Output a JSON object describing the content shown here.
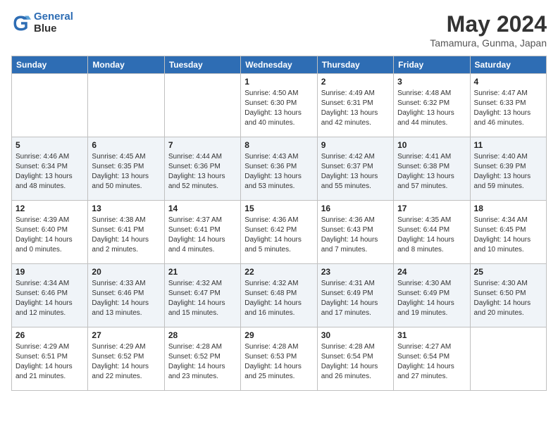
{
  "header": {
    "logo_line1": "General",
    "logo_line2": "Blue",
    "month_year": "May 2024",
    "location": "Tamamura, Gunma, Japan"
  },
  "weekdays": [
    "Sunday",
    "Monday",
    "Tuesday",
    "Wednesday",
    "Thursday",
    "Friday",
    "Saturday"
  ],
  "weeks": [
    [
      {
        "day": "",
        "info": ""
      },
      {
        "day": "",
        "info": ""
      },
      {
        "day": "",
        "info": ""
      },
      {
        "day": "1",
        "info": "Sunrise: 4:50 AM\nSunset: 6:30 PM\nDaylight: 13 hours\nand 40 minutes."
      },
      {
        "day": "2",
        "info": "Sunrise: 4:49 AM\nSunset: 6:31 PM\nDaylight: 13 hours\nand 42 minutes."
      },
      {
        "day": "3",
        "info": "Sunrise: 4:48 AM\nSunset: 6:32 PM\nDaylight: 13 hours\nand 44 minutes."
      },
      {
        "day": "4",
        "info": "Sunrise: 4:47 AM\nSunset: 6:33 PM\nDaylight: 13 hours\nand 46 minutes."
      }
    ],
    [
      {
        "day": "5",
        "info": "Sunrise: 4:46 AM\nSunset: 6:34 PM\nDaylight: 13 hours\nand 48 minutes."
      },
      {
        "day": "6",
        "info": "Sunrise: 4:45 AM\nSunset: 6:35 PM\nDaylight: 13 hours\nand 50 minutes."
      },
      {
        "day": "7",
        "info": "Sunrise: 4:44 AM\nSunset: 6:36 PM\nDaylight: 13 hours\nand 52 minutes."
      },
      {
        "day": "8",
        "info": "Sunrise: 4:43 AM\nSunset: 6:36 PM\nDaylight: 13 hours\nand 53 minutes."
      },
      {
        "day": "9",
        "info": "Sunrise: 4:42 AM\nSunset: 6:37 PM\nDaylight: 13 hours\nand 55 minutes."
      },
      {
        "day": "10",
        "info": "Sunrise: 4:41 AM\nSunset: 6:38 PM\nDaylight: 13 hours\nand 57 minutes."
      },
      {
        "day": "11",
        "info": "Sunrise: 4:40 AM\nSunset: 6:39 PM\nDaylight: 13 hours\nand 59 minutes."
      }
    ],
    [
      {
        "day": "12",
        "info": "Sunrise: 4:39 AM\nSunset: 6:40 PM\nDaylight: 14 hours\nand 0 minutes."
      },
      {
        "day": "13",
        "info": "Sunrise: 4:38 AM\nSunset: 6:41 PM\nDaylight: 14 hours\nand 2 minutes."
      },
      {
        "day": "14",
        "info": "Sunrise: 4:37 AM\nSunset: 6:41 PM\nDaylight: 14 hours\nand 4 minutes."
      },
      {
        "day": "15",
        "info": "Sunrise: 4:36 AM\nSunset: 6:42 PM\nDaylight: 14 hours\nand 5 minutes."
      },
      {
        "day": "16",
        "info": "Sunrise: 4:36 AM\nSunset: 6:43 PM\nDaylight: 14 hours\nand 7 minutes."
      },
      {
        "day": "17",
        "info": "Sunrise: 4:35 AM\nSunset: 6:44 PM\nDaylight: 14 hours\nand 8 minutes."
      },
      {
        "day": "18",
        "info": "Sunrise: 4:34 AM\nSunset: 6:45 PM\nDaylight: 14 hours\nand 10 minutes."
      }
    ],
    [
      {
        "day": "19",
        "info": "Sunrise: 4:34 AM\nSunset: 6:46 PM\nDaylight: 14 hours\nand 12 minutes."
      },
      {
        "day": "20",
        "info": "Sunrise: 4:33 AM\nSunset: 6:46 PM\nDaylight: 14 hours\nand 13 minutes."
      },
      {
        "day": "21",
        "info": "Sunrise: 4:32 AM\nSunset: 6:47 PM\nDaylight: 14 hours\nand 15 minutes."
      },
      {
        "day": "22",
        "info": "Sunrise: 4:32 AM\nSunset: 6:48 PM\nDaylight: 14 hours\nand 16 minutes."
      },
      {
        "day": "23",
        "info": "Sunrise: 4:31 AM\nSunset: 6:49 PM\nDaylight: 14 hours\nand 17 minutes."
      },
      {
        "day": "24",
        "info": "Sunrise: 4:30 AM\nSunset: 6:49 PM\nDaylight: 14 hours\nand 19 minutes."
      },
      {
        "day": "25",
        "info": "Sunrise: 4:30 AM\nSunset: 6:50 PM\nDaylight: 14 hours\nand 20 minutes."
      }
    ],
    [
      {
        "day": "26",
        "info": "Sunrise: 4:29 AM\nSunset: 6:51 PM\nDaylight: 14 hours\nand 21 minutes."
      },
      {
        "day": "27",
        "info": "Sunrise: 4:29 AM\nSunset: 6:52 PM\nDaylight: 14 hours\nand 22 minutes."
      },
      {
        "day": "28",
        "info": "Sunrise: 4:28 AM\nSunset: 6:52 PM\nDaylight: 14 hours\nand 23 minutes."
      },
      {
        "day": "29",
        "info": "Sunrise: 4:28 AM\nSunset: 6:53 PM\nDaylight: 14 hours\nand 25 minutes."
      },
      {
        "day": "30",
        "info": "Sunrise: 4:28 AM\nSunset: 6:54 PM\nDaylight: 14 hours\nand 26 minutes."
      },
      {
        "day": "31",
        "info": "Sunrise: 4:27 AM\nSunset: 6:54 PM\nDaylight: 14 hours\nand 27 minutes."
      },
      {
        "day": "",
        "info": ""
      }
    ]
  ]
}
